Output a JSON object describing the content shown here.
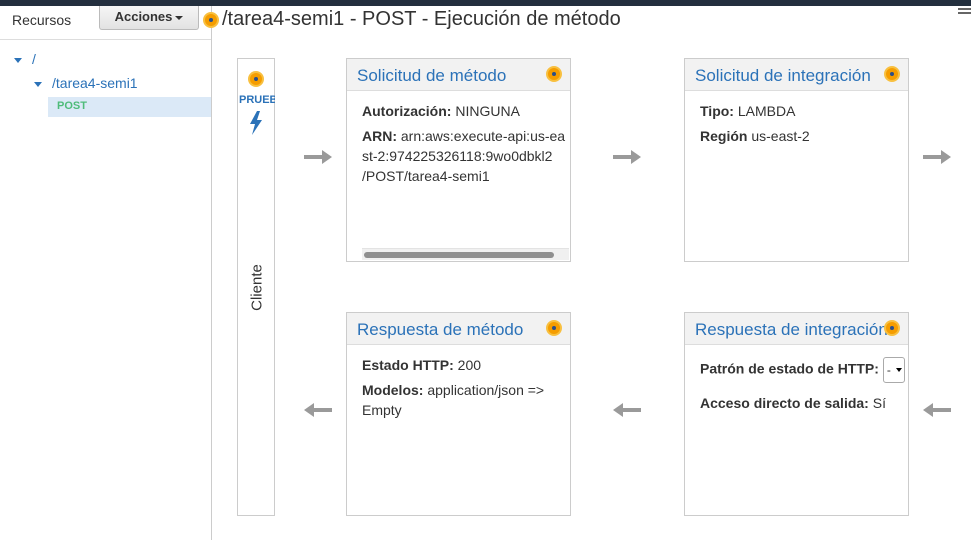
{
  "sidebar": {
    "title": "Recursos",
    "actions_label": "Acciones",
    "tree": {
      "root": "/",
      "child": "/tarea4-semi1",
      "method": "POST"
    }
  },
  "main": {
    "title": "/tarea4-semi1 - POST - Ejecución de método"
  },
  "client": {
    "test_label": "PRUEBA",
    "label": "Cliente"
  },
  "method_request": {
    "title": "Solicitud de método",
    "auth_label": "Autorización:",
    "auth_value": "NINGUNA",
    "arn_label": "ARN:",
    "arn_value": "arn:aws:execute-api:us-east-2:974225326118:9wo0dbkl2",
    "arn_value2": "/POST/tarea4-semi1"
  },
  "integration_request": {
    "title": "Solicitud de integración",
    "type_label": "Tipo:",
    "type_value": "LAMBDA",
    "region_label": "Región",
    "region_value": "us-east-2"
  },
  "method_response": {
    "title": "Respuesta de método",
    "status_label": "Estado HTTP:",
    "status_value": "200",
    "models_label": "Modelos:",
    "models_value": "application/json => Empty"
  },
  "integration_response": {
    "title": "Respuesta de integración",
    "pattern_label": "Patrón de estado de HTTP:",
    "pattern_value": "-",
    "passthrough_label": "Acceso directo de salida:",
    "passthrough_value": "Sí"
  },
  "colors": {
    "link": "#2b72b8",
    "method_green": "#4fbc7a",
    "accent_orange": "#f59d00",
    "arrow_gray": "#9a9a9a"
  }
}
